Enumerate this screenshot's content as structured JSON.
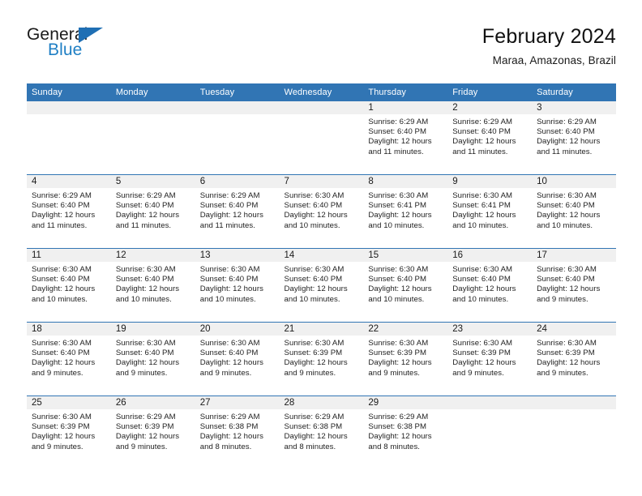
{
  "brand": {
    "name_part1": "General",
    "name_part2": "Blue",
    "triangle_icon": "triangle-icon",
    "accent_color": "#1f6fb4"
  },
  "header": {
    "title": "February 2024",
    "subtitle": "Maraa, Amazonas, Brazil"
  },
  "calendar": {
    "header_bg": "#3175b4",
    "daynum_bg": "#f0f0f0",
    "weekdays": [
      "Sunday",
      "Monday",
      "Tuesday",
      "Wednesday",
      "Thursday",
      "Friday",
      "Saturday"
    ],
    "labels": {
      "sunrise": "Sunrise:",
      "sunset": "Sunset:",
      "daylight": "Daylight:"
    },
    "weeks": [
      [
        {
          "day": ""
        },
        {
          "day": ""
        },
        {
          "day": ""
        },
        {
          "day": ""
        },
        {
          "day": "1",
          "sunrise": "Sunrise: 6:29 AM",
          "sunset": "Sunset: 6:40 PM",
          "daylight": "Daylight: 12 hours and 11 minutes."
        },
        {
          "day": "2",
          "sunrise": "Sunrise: 6:29 AM",
          "sunset": "Sunset: 6:40 PM",
          "daylight": "Daylight: 12 hours and 11 minutes."
        },
        {
          "day": "3",
          "sunrise": "Sunrise: 6:29 AM",
          "sunset": "Sunset: 6:40 PM",
          "daylight": "Daylight: 12 hours and 11 minutes."
        }
      ],
      [
        {
          "day": "4",
          "sunrise": "Sunrise: 6:29 AM",
          "sunset": "Sunset: 6:40 PM",
          "daylight": "Daylight: 12 hours and 11 minutes."
        },
        {
          "day": "5",
          "sunrise": "Sunrise: 6:29 AM",
          "sunset": "Sunset: 6:40 PM",
          "daylight": "Daylight: 12 hours and 11 minutes."
        },
        {
          "day": "6",
          "sunrise": "Sunrise: 6:29 AM",
          "sunset": "Sunset: 6:40 PM",
          "daylight": "Daylight: 12 hours and 11 minutes."
        },
        {
          "day": "7",
          "sunrise": "Sunrise: 6:30 AM",
          "sunset": "Sunset: 6:40 PM",
          "daylight": "Daylight: 12 hours and 10 minutes."
        },
        {
          "day": "8",
          "sunrise": "Sunrise: 6:30 AM",
          "sunset": "Sunset: 6:41 PM",
          "daylight": "Daylight: 12 hours and 10 minutes."
        },
        {
          "day": "9",
          "sunrise": "Sunrise: 6:30 AM",
          "sunset": "Sunset: 6:41 PM",
          "daylight": "Daylight: 12 hours and 10 minutes."
        },
        {
          "day": "10",
          "sunrise": "Sunrise: 6:30 AM",
          "sunset": "Sunset: 6:40 PM",
          "daylight": "Daylight: 12 hours and 10 minutes."
        }
      ],
      [
        {
          "day": "11",
          "sunrise": "Sunrise: 6:30 AM",
          "sunset": "Sunset: 6:40 PM",
          "daylight": "Daylight: 12 hours and 10 minutes."
        },
        {
          "day": "12",
          "sunrise": "Sunrise: 6:30 AM",
          "sunset": "Sunset: 6:40 PM",
          "daylight": "Daylight: 12 hours and 10 minutes."
        },
        {
          "day": "13",
          "sunrise": "Sunrise: 6:30 AM",
          "sunset": "Sunset: 6:40 PM",
          "daylight": "Daylight: 12 hours and 10 minutes."
        },
        {
          "day": "14",
          "sunrise": "Sunrise: 6:30 AM",
          "sunset": "Sunset: 6:40 PM",
          "daylight": "Daylight: 12 hours and 10 minutes."
        },
        {
          "day": "15",
          "sunrise": "Sunrise: 6:30 AM",
          "sunset": "Sunset: 6:40 PM",
          "daylight": "Daylight: 12 hours and 10 minutes."
        },
        {
          "day": "16",
          "sunrise": "Sunrise: 6:30 AM",
          "sunset": "Sunset: 6:40 PM",
          "daylight": "Daylight: 12 hours and 10 minutes."
        },
        {
          "day": "17",
          "sunrise": "Sunrise: 6:30 AM",
          "sunset": "Sunset: 6:40 PM",
          "daylight": "Daylight: 12 hours and 9 minutes."
        }
      ],
      [
        {
          "day": "18",
          "sunrise": "Sunrise: 6:30 AM",
          "sunset": "Sunset: 6:40 PM",
          "daylight": "Daylight: 12 hours and 9 minutes."
        },
        {
          "day": "19",
          "sunrise": "Sunrise: 6:30 AM",
          "sunset": "Sunset: 6:40 PM",
          "daylight": "Daylight: 12 hours and 9 minutes."
        },
        {
          "day": "20",
          "sunrise": "Sunrise: 6:30 AM",
          "sunset": "Sunset: 6:40 PM",
          "daylight": "Daylight: 12 hours and 9 minutes."
        },
        {
          "day": "21",
          "sunrise": "Sunrise: 6:30 AM",
          "sunset": "Sunset: 6:39 PM",
          "daylight": "Daylight: 12 hours and 9 minutes."
        },
        {
          "day": "22",
          "sunrise": "Sunrise: 6:30 AM",
          "sunset": "Sunset: 6:39 PM",
          "daylight": "Daylight: 12 hours and 9 minutes."
        },
        {
          "day": "23",
          "sunrise": "Sunrise: 6:30 AM",
          "sunset": "Sunset: 6:39 PM",
          "daylight": "Daylight: 12 hours and 9 minutes."
        },
        {
          "day": "24",
          "sunrise": "Sunrise: 6:30 AM",
          "sunset": "Sunset: 6:39 PM",
          "daylight": "Daylight: 12 hours and 9 minutes."
        }
      ],
      [
        {
          "day": "25",
          "sunrise": "Sunrise: 6:30 AM",
          "sunset": "Sunset: 6:39 PM",
          "daylight": "Daylight: 12 hours and 9 minutes."
        },
        {
          "day": "26",
          "sunrise": "Sunrise: 6:29 AM",
          "sunset": "Sunset: 6:39 PM",
          "daylight": "Daylight: 12 hours and 9 minutes."
        },
        {
          "day": "27",
          "sunrise": "Sunrise: 6:29 AM",
          "sunset": "Sunset: 6:38 PM",
          "daylight": "Daylight: 12 hours and 8 minutes."
        },
        {
          "day": "28",
          "sunrise": "Sunrise: 6:29 AM",
          "sunset": "Sunset: 6:38 PM",
          "daylight": "Daylight: 12 hours and 8 minutes."
        },
        {
          "day": "29",
          "sunrise": "Sunrise: 6:29 AM",
          "sunset": "Sunset: 6:38 PM",
          "daylight": "Daylight: 12 hours and 8 minutes."
        },
        {
          "day": ""
        },
        {
          "day": ""
        }
      ]
    ]
  }
}
